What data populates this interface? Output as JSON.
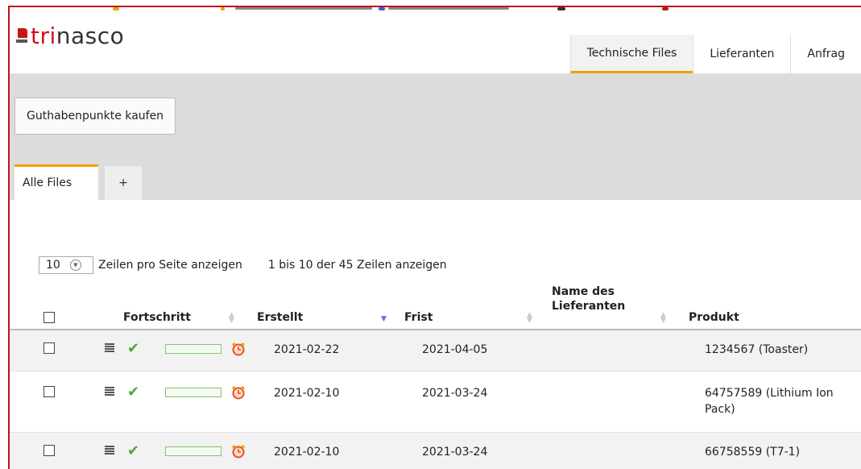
{
  "app": {
    "logo_prefix": "tri",
    "logo_suffix": "nasco"
  },
  "nav": {
    "tabs": [
      {
        "label": "Technische Files",
        "active": true
      },
      {
        "label": "Lieferanten",
        "active": false
      },
      {
        "label": "Anfrag",
        "active": false
      }
    ]
  },
  "toolbar": {
    "buy_label": "Guthabenpunkte kaufen"
  },
  "subtabs": {
    "all_label": "Alle Files",
    "add_label": "+"
  },
  "pager": {
    "page_size": "10",
    "per_page_text": "Zeilen pro Seite anzeigen",
    "range_text": "1 bis 10 der 45 Zeilen anzeigen"
  },
  "table": {
    "headers": {
      "progress": "Fortschritt",
      "created": "Erstellt",
      "deadline": "Frist",
      "supplier_line1": "Name des",
      "supplier_line2": "Lieferanten",
      "product": "Produkt"
    },
    "rows": [
      {
        "created": "2021-02-22",
        "deadline": "2021-04-05",
        "supplier": "",
        "product_line1": "1234567 (Toaster)",
        "product_line2": "",
        "progress": 0
      },
      {
        "created": "2021-02-10",
        "deadline": "2021-03-24",
        "supplier": "",
        "product_line1": "64757589 (Lithium Ion",
        "product_line2": "Pack)",
        "progress": 0
      },
      {
        "created": "2021-02-10",
        "deadline": "2021-03-24",
        "supplier": "",
        "product_line1": "66758559 (T7-1)",
        "product_line2": "",
        "progress": 0
      }
    ]
  },
  "colors": {
    "accent": "#f2a000",
    "brand_red": "#c8141c",
    "check_green": "#4caa34",
    "sort_active": "#5b6fd1"
  }
}
